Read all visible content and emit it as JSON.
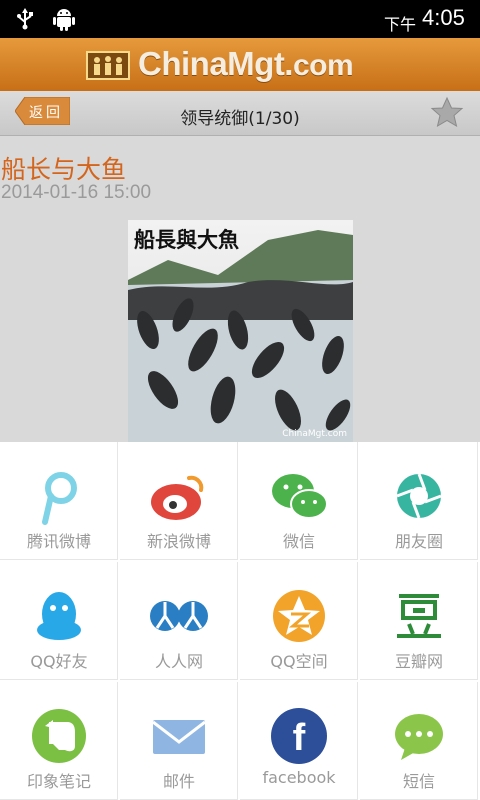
{
  "status_bar": {
    "ampm": "下午",
    "time": "4:05",
    "icons": [
      "usb-icon",
      "android-debug-icon"
    ]
  },
  "header": {
    "logo_main": "ChinaMgt.",
    "logo_suffix": "com"
  },
  "title_bar": {
    "back_label": "返回",
    "title": "领导统御(1/30)"
  },
  "article": {
    "title": "船长与大鱼",
    "date": "2014-01-16 15:00",
    "image_caption": "船長與大魚",
    "image_watermark": "ChinaMgt.com"
  },
  "share": {
    "items": [
      {
        "label": "腾讯微博",
        "icon": "tencent-weibo-icon",
        "color": "#7fd3e6"
      },
      {
        "label": "新浪微博",
        "icon": "sina-weibo-icon",
        "color": "#e0463c"
      },
      {
        "label": "微信",
        "icon": "wechat-icon",
        "color": "#4cb34c"
      },
      {
        "label": "朋友圈",
        "icon": "moments-icon",
        "color": "#38b5a0"
      },
      {
        "label": "QQ好友",
        "icon": "qq-icon",
        "color": "#29a8e8"
      },
      {
        "label": "人人网",
        "icon": "renren-icon",
        "color": "#2a7fc4"
      },
      {
        "label": "QQ空间",
        "icon": "qzone-icon",
        "color": "#f2a32a"
      },
      {
        "label": "豆瓣网",
        "icon": "douban-icon",
        "color": "#2e8b3a"
      },
      {
        "label": "印象笔记",
        "icon": "evernote-icon",
        "color": "#7bc043"
      },
      {
        "label": "邮件",
        "icon": "email-icon",
        "color": "#8fb6e3"
      },
      {
        "label": "facebook",
        "icon": "facebook-icon",
        "color": "#2d4f9a"
      },
      {
        "label": "短信",
        "icon": "sms-icon",
        "color": "#8bc64a"
      }
    ]
  }
}
